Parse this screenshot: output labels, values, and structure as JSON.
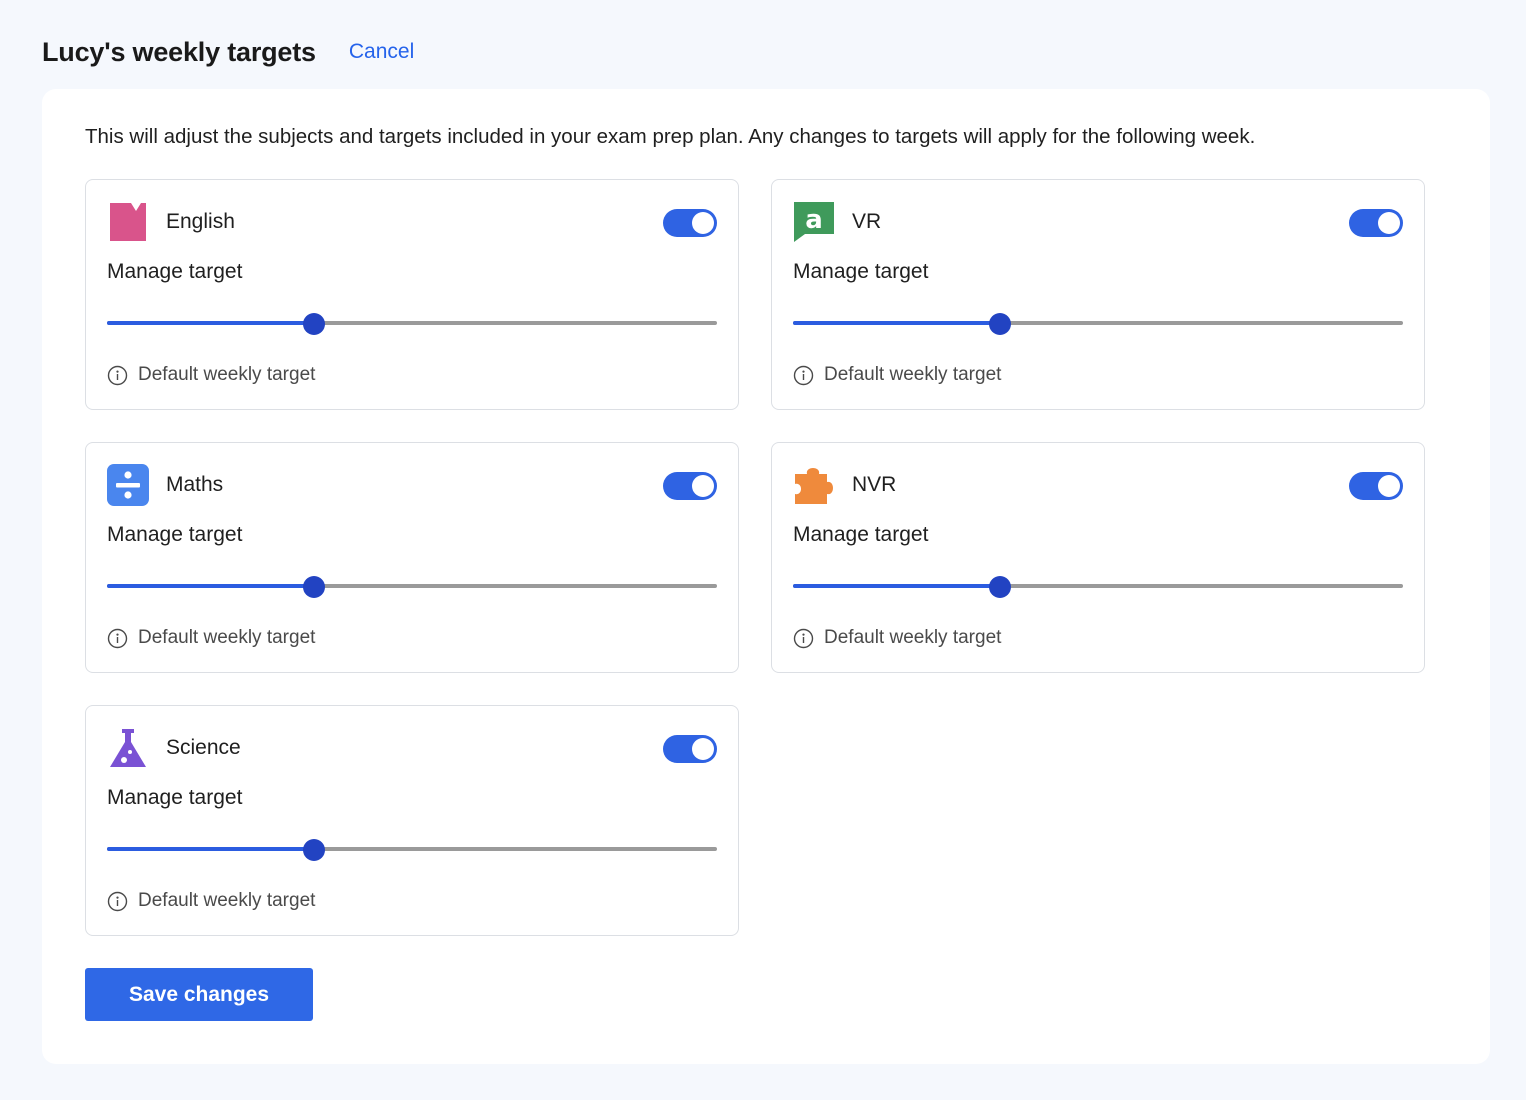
{
  "header": {
    "title": "Lucy's weekly targets",
    "cancel_label": "Cancel"
  },
  "panel": {
    "description": "This will adjust the subjects and targets included in your exam prep plan. Any changes to targets will apply for the following week."
  },
  "subjects": [
    {
      "name": "English",
      "icon": "english-book-icon",
      "icon_color": "#d9548b",
      "enabled": true,
      "manage_label": "Manage target",
      "target_fraction": 0.34,
      "hint": "Default weekly target"
    },
    {
      "name": "VR",
      "icon": "vr-speech-a-icon",
      "icon_color": "#3f9a5b",
      "enabled": true,
      "manage_label": "Manage target",
      "target_fraction": 0.34,
      "hint": "Default weekly target"
    },
    {
      "name": "Maths",
      "icon": "maths-divide-icon",
      "icon_color": "#4a86ee",
      "enabled": true,
      "manage_label": "Manage target",
      "target_fraction": 0.34,
      "hint": "Default weekly target"
    },
    {
      "name": "NVR",
      "icon": "nvr-puzzle-icon",
      "icon_color": "#ef8a3c",
      "enabled": true,
      "manage_label": "Manage target",
      "target_fraction": 0.34,
      "hint": "Default weekly target"
    },
    {
      "name": "Science",
      "icon": "science-flask-icon",
      "icon_color": "#7a52d4",
      "enabled": true,
      "manage_label": "Manage target",
      "target_fraction": 0.34,
      "hint": "Default weekly target"
    }
  ],
  "footer": {
    "save_label": "Save changes"
  },
  "colors": {
    "accent": "#2f68e6",
    "slider_fill": "#2b5ce0",
    "slider_thumb": "#2243c2",
    "track": "#9a9a9a"
  }
}
